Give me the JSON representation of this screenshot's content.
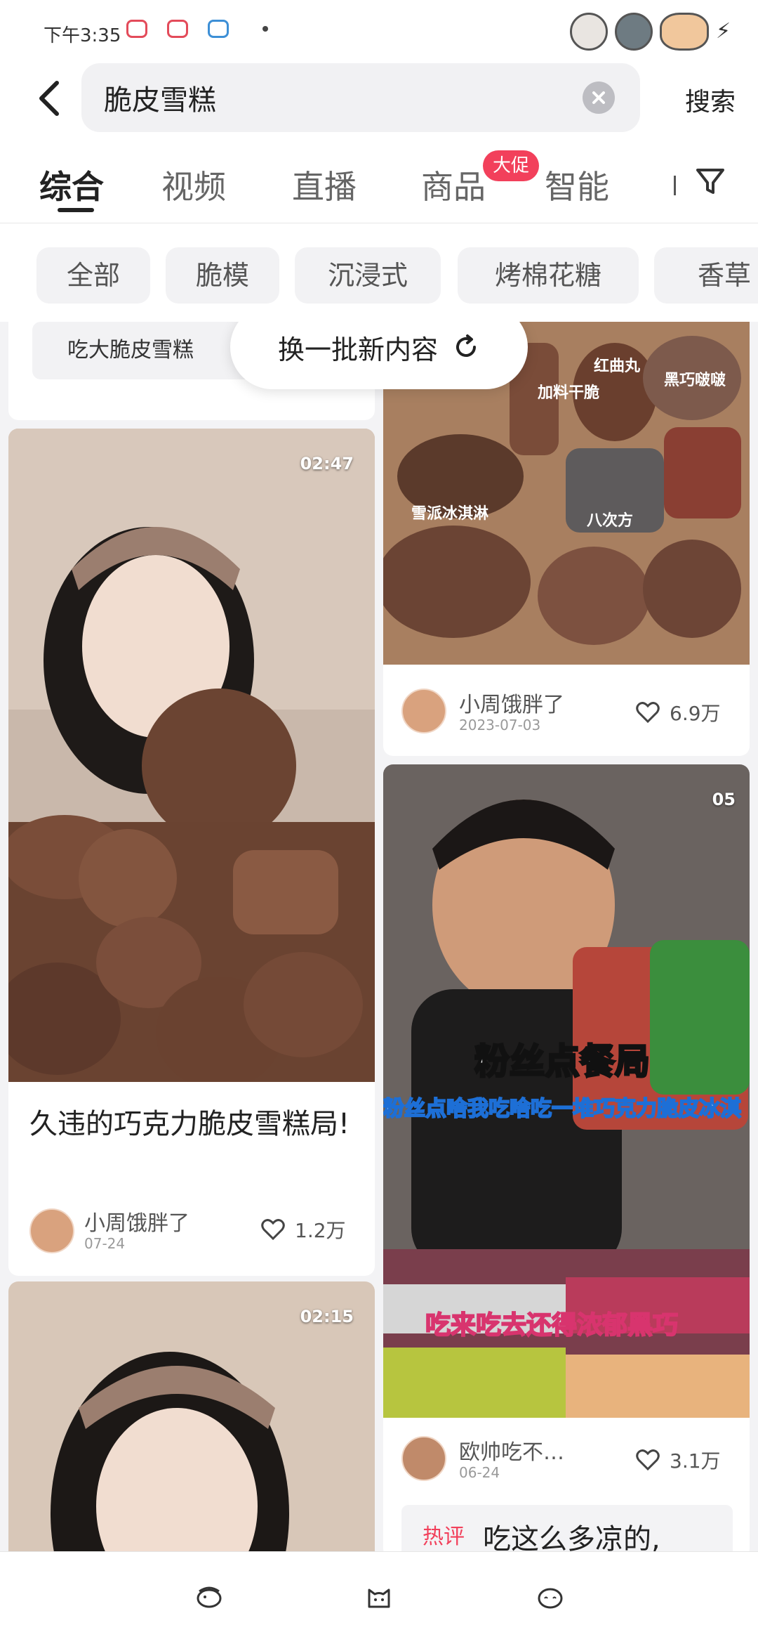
{
  "status_bar": {
    "time": "下午3:35"
  },
  "search": {
    "query": "脆皮雪糕",
    "submit_label": "搜索"
  },
  "tabs": [
    {
      "label": "综合",
      "active": true
    },
    {
      "label": "视频"
    },
    {
      "label": "直播"
    },
    {
      "label": "商品"
    },
    {
      "label": "智能"
    }
  ],
  "promo_badge": "大促",
  "chips": [
    "全部",
    "脆模",
    "沉浸式",
    "烤棉花糖",
    "香草"
  ],
  "refresh_label": "换一批新内容",
  "feed": {
    "top_snippet": "吃大脆皮雪糕",
    "cards": [
      {
        "duration": "02:47",
        "title": "久违的巧克力脆皮雪糕局!",
        "author": "小周饿胖了",
        "date": "07-24",
        "likes": "1.2万"
      },
      {
        "duration": "02:15"
      },
      {
        "overlay_labels": [
          "红曲丸",
          "黑巧啵啵",
          "加料干脆",
          "雪派冰淇淋",
          "八次方"
        ],
        "author": "小周饿胖了",
        "date": "2023-07-03",
        "likes": "6.9万"
      },
      {
        "duration": "05",
        "overlay_title": "粉丝点餐局",
        "overlay_subtitle": "粉丝点啥我吃啥吃一堆巧克力脆皮冰淇",
        "overlay_bottom": "吃来吃去还得浓郁黑巧",
        "author": "欧帅吃不…",
        "date": "06-24",
        "likes": "3.1万",
        "hot_comment_tag": "热评",
        "hot_comment": "吃这么多凉的,"
      }
    ]
  },
  "colors": {
    "accent": "#f2405b",
    "background": "#f3f3f5"
  }
}
